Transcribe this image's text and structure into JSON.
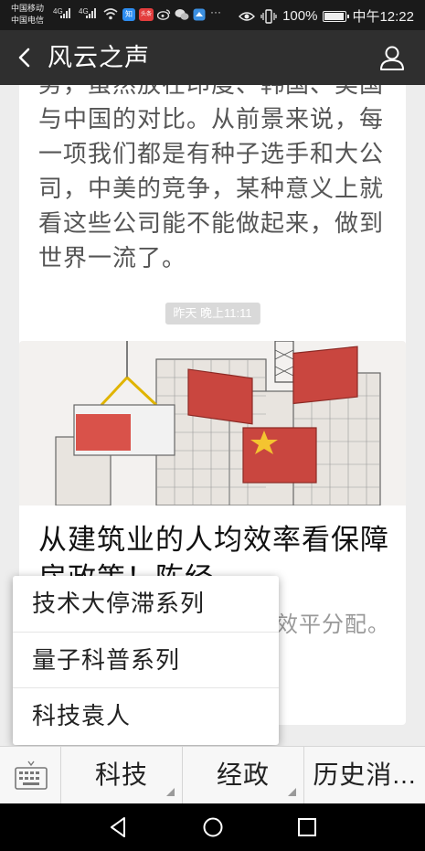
{
  "status_bar": {
    "carrier1": "中国移动",
    "carrier2": "中国电信",
    "net1": "4G",
    "net2": "4G",
    "app_icons": [
      {
        "name": "zhihu-icon",
        "label": "知",
        "color": "#2d8cf0"
      },
      {
        "name": "toutiao-icon",
        "label": "头条",
        "color": "#e33d3d"
      },
      {
        "name": "weibo-icon",
        "label": "",
        "color": "#444444"
      },
      {
        "name": "wechat-icon",
        "label": "",
        "color": "#444444"
      },
      {
        "name": "qq-browser-icon",
        "label": "",
        "color": "#3b8fe0"
      }
    ],
    "more": "···",
    "battery_percent": "100%",
    "battery_level": 1.0,
    "time": "中午12:22"
  },
  "header": {
    "title": "风云之声"
  },
  "messages": {
    "previous_text": "势，虽然放在印度、韩国、美国与中国的对比。从前景来说，每一项我们都是有种子选手和大公司，中美的竞争，某种意义上就看这些公司能不能做起来，做到世界一流了。",
    "timestamp": "昨天 晚上11:11",
    "article": {
      "image_label": "保障房",
      "title": "从建筑业的人均效率看保障房政策！陈经",
      "summary": "事。效率率，高效平分配。"
    }
  },
  "popup_menu": {
    "items": [
      {
        "label": "技术大停滞系列"
      },
      {
        "label": "量子科普系列"
      },
      {
        "label": "科技袁人"
      }
    ]
  },
  "bottom_menu": {
    "tabs": [
      {
        "label": "科技"
      },
      {
        "label": "经政"
      },
      {
        "label": "历史消..."
      }
    ]
  },
  "colors": {
    "title_bar": "#2f2f2f",
    "status_bar": "#1a1a1a",
    "chat_bg": "#ededed",
    "summary_text": "#999999"
  }
}
